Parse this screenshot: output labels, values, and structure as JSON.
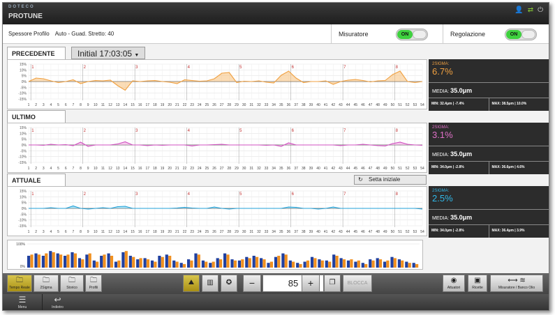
{
  "app": {
    "logo": "DOTECO",
    "title": "PROTUNE"
  },
  "status": {
    "spessore_label": "Spessore Profilo",
    "spessore_value": "Auto - Guad. Stretto: 40",
    "misuratore_label": "Misuratore",
    "misuratore_state": "ON",
    "regolazione_label": "Regolazione",
    "regolazione_state": "ON"
  },
  "sections": [
    {
      "tab": "PRECEDENTE",
      "time": "Initial 17:03:05",
      "sigma_label": "2SIGMA:",
      "sigma": "6.7%",
      "sigma_color": "#f0a040",
      "media_label": "MEDIA:",
      "media": "35.0μm",
      "min": "MIN: 32.4μm | -7.4%",
      "max": "MAX: 38.5μm | 10.0%",
      "line_color": "#f0a040",
      "fill_color": "#f5c07a"
    },
    {
      "tab": "ULTIMO",
      "sigma_label": "2SIGMA:",
      "sigma": "3.1%",
      "sigma_color": "#e070c8",
      "media_label": "MEDIA:",
      "media": "35.0μm",
      "min": "MIN: 34.0μm | -2.8%",
      "max": "MAX: 36.6μm | 4.6%",
      "line_color": "#d050c0",
      "fill_color": "#f0a0e0"
    },
    {
      "tab": "ATTUALE",
      "button": "Setta iniziale",
      "sigma_label": "2SIGMA:",
      "sigma": "2.5%",
      "sigma_color": "#30b8e8",
      "media_label": "MEDIA:",
      "media": "35.0μm",
      "min": "MIN: 34.0μm | -2.8%",
      "max": "MAX: 36.4μm | 3.9%",
      "line_color": "#20a0d8",
      "fill_color": "#70d0f0"
    }
  ],
  "yticks": [
    "15%",
    "10%",
    "5%",
    "0%",
    "-5%",
    "-10%",
    "-15%"
  ],
  "hist_ticks": [
    "100%",
    "0%"
  ],
  "markers": [
    "1",
    "2",
    "3",
    "4",
    "5",
    "6",
    "7",
    "8"
  ],
  "xlabels": [
    "1",
    "2",
    "3",
    "4",
    "5",
    "6",
    "7",
    "8",
    "9",
    "10",
    "11",
    "12",
    "13",
    "14",
    "15",
    "16",
    "17",
    "18",
    "19",
    "20",
    "21",
    "22",
    "23",
    "24",
    "25",
    "26",
    "27",
    "28",
    "29",
    "30",
    "31",
    "32",
    "33",
    "34",
    "35",
    "36",
    "37",
    "38",
    "39",
    "40",
    "41",
    "42",
    "43",
    "44",
    "45",
    "46",
    "47",
    "48",
    "49",
    "50",
    "51",
    "52",
    "53",
    "54"
  ],
  "series": {
    "precedente": [
      0,
      1,
      0.8,
      0.2,
      -0.3,
      0,
      0.5,
      -0.6,
      0,
      0.3,
      0.2,
      0.4,
      -1.2,
      -2.5,
      0.2,
      0,
      0.2,
      0.3,
      0,
      -0.2,
      -0.6,
      0.5,
      0.3,
      0.1,
      0.2,
      0.8,
      2.4,
      2.6,
      -0.3,
      0.1,
      0,
      0.2,
      -0.2,
      -0.4,
      1.8,
      3.0,
      1.0,
      -0.3,
      0,
      0,
      0.2,
      -0.8,
      0,
      0.4,
      0.6,
      0.3,
      -0.1,
      0.2,
      0.3,
      2.0,
      3.0,
      0,
      -0.3,
      0
    ],
    "ultimo": [
      0,
      0,
      -0.1,
      0.2,
      0,
      0.1,
      -0.2,
      0.8,
      -0.4,
      0,
      0,
      0,
      0.3,
      0.9,
      0,
      0,
      -0.2,
      0,
      -0.1,
      0,
      0,
      0,
      -0.3,
      0,
      0,
      0.1,
      0.2,
      0,
      0,
      0,
      0,
      0,
      -0.1,
      0,
      -0.4,
      0.6,
      0,
      0,
      0,
      0,
      0,
      0,
      -0.2,
      0,
      0,
      0.2,
      0,
      -0.2,
      -0.3,
      0.4,
      0.8,
      0.2,
      0,
      -0.1
    ],
    "attuale": [
      0,
      0,
      0,
      0.2,
      0,
      0,
      0.7,
      0,
      -0.2,
      0,
      0.2,
      0,
      0.5,
      0.6,
      0,
      0,
      0,
      0,
      0,
      0,
      0.1,
      0.3,
      0.1,
      0,
      0,
      0.4,
      0,
      -0.2,
      0,
      0,
      0,
      0,
      0,
      0,
      0,
      0.4,
      0.3,
      0,
      0,
      -0.2,
      0,
      0.4,
      0,
      0,
      0,
      0,
      0,
      0,
      0,
      0,
      0,
      0,
      0,
      -0.2
    ]
  },
  "hist_values": [
    [
      0.5,
      0.55
    ],
    [
      0.6,
      0.55
    ],
    [
      0.5,
      0.6
    ],
    [
      0.7,
      0.65
    ],
    [
      0.6,
      0.55
    ],
    [
      0.5,
      0.55
    ],
    [
      0.65,
      0.6
    ],
    [
      0.4,
      0.35
    ],
    [
      0.55,
      0.6
    ],
    [
      0.3,
      0.25
    ],
    [
      0.5,
      0.55
    ],
    [
      0.6,
      0.5
    ],
    [
      0.25,
      0.3
    ],
    [
      0.65,
      0.7
    ],
    [
      0.5,
      0.45
    ],
    [
      0.35,
      0.4
    ],
    [
      0.4,
      0.35
    ],
    [
      0.3,
      0.25
    ],
    [
      0.5,
      0.45
    ],
    [
      0.55,
      0.5
    ],
    [
      0.3,
      0.25
    ],
    [
      0.2,
      0.15
    ],
    [
      0.35,
      0.3
    ],
    [
      0.6,
      0.55
    ],
    [
      0.3,
      0.25
    ],
    [
      0.2,
      0.25
    ],
    [
      0.4,
      0.35
    ],
    [
      0.6,
      0.55
    ],
    [
      0.35,
      0.3
    ],
    [
      0.3,
      0.35
    ],
    [
      0.45,
      0.4
    ],
    [
      0.5,
      0.45
    ],
    [
      0.4,
      0.35
    ],
    [
      0.2,
      0.25
    ],
    [
      0.45,
      0.5
    ],
    [
      0.6,
      0.55
    ],
    [
      0.3,
      0.25
    ],
    [
      0.2,
      0.15
    ],
    [
      0.25,
      0.3
    ],
    [
      0.45,
      0.4
    ],
    [
      0.35,
      0.3
    ],
    [
      0.3,
      0.25
    ],
    [
      0.55,
      0.5
    ],
    [
      0.4,
      0.35
    ],
    [
      0.3,
      0.35
    ],
    [
      0.25,
      0.3
    ],
    [
      0.2,
      0.15
    ],
    [
      0.35,
      0.3
    ],
    [
      0.4,
      0.35
    ],
    [
      0.25,
      0.3
    ],
    [
      0.45,
      0.4
    ],
    [
      0.35,
      0.3
    ],
    [
      0.25,
      0.2
    ],
    [
      0.2,
      0.15
    ]
  ],
  "hist_colors": [
    "#2040a0",
    "#f09020"
  ],
  "toolbar": {
    "tempo_reale": "Tempo Reale",
    "sigma2": "2Sigma",
    "storico": "Storico",
    "profili": "Profili",
    "value": "85",
    "blocca": "BLOCCA",
    "attuatori": "Attuatori",
    "ricette": "Ricette",
    "misuratore_banco": "Misuratore / Banco Olio"
  },
  "bottom": {
    "menu": "Menu",
    "indietro": "Indietro"
  }
}
